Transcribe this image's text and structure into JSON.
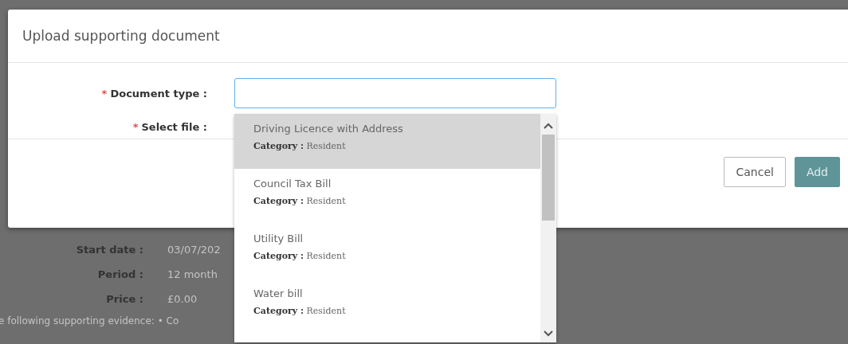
{
  "background_page": {
    "details": [
      {
        "label": "Start date :",
        "value": "03/07/202"
      },
      {
        "label": "Period :",
        "value": "12 month"
      },
      {
        "label": "Price :",
        "value": "£0.00"
      }
    ],
    "evidence_text": "e following supporting evidence: • Co"
  },
  "dialog": {
    "title": "Upload supporting document",
    "fields": [
      {
        "required_mark": "*",
        "label": "Document type :",
        "kind": "combo"
      },
      {
        "required_mark": "*",
        "label": "Select file :",
        "kind": "file"
      }
    ],
    "buttons": [
      {
        "label": "Cancel",
        "kind": "secondary"
      },
      {
        "label": "Add",
        "kind": "primary"
      }
    ]
  },
  "dropdown": {
    "options": [
      {
        "name": "Driving Licence with Address",
        "category_label": "Category :",
        "category": "Resident",
        "selected": true
      },
      {
        "name": "Council Tax Bill",
        "category_label": "Category :",
        "category": "Resident",
        "selected": false
      },
      {
        "name": "Utility Bill",
        "category_label": "Category :",
        "category": "Resident",
        "selected": false
      },
      {
        "name": "Water bill",
        "category_label": "Category :",
        "category": "Resident",
        "selected": false
      }
    ]
  }
}
